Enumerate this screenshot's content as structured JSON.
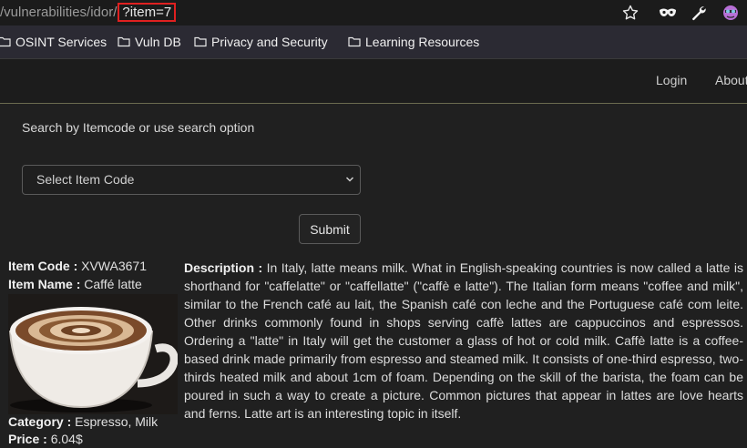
{
  "browser": {
    "url_path": "/vulnerabilities/idor/",
    "url_query": "?item=7"
  },
  "bookmarks": [
    {
      "label": "OSINT Services"
    },
    {
      "label": "Vuln DB"
    },
    {
      "label": "Privacy and Security"
    },
    {
      "label": "Learning Resources"
    }
  ],
  "nav": {
    "login": "Login",
    "about": "About"
  },
  "search": {
    "label": "Search by Itemcode or use search option",
    "select_value": "Select Item Code",
    "submit": "Submit"
  },
  "item": {
    "code_label": "Item Code :",
    "code": " XVWA3671",
    "name_label": "Item Name :",
    "name": " Caffé latte",
    "category_label": "Category :",
    "category": " Espresso, Milk",
    "price_label": "Price :",
    "price": " 6.04$",
    "description_label": "Description :",
    "description": " In Italy, latte means milk. What in English-speaking countries is now called a latte is shorthand for \"caffelatte\" or \"caffellatte\" (\"caffè e latte\"). The Italian form means \"coffee and milk\", similar to the French café au lait, the Spanish café con leche and the Portuguese café com leite. Other drinks commonly found in shops serving caffè lattes are cappuccinos and espressos. Ordering a \"latte\" in Italy will get the customer a glass of hot or cold milk. Caffè latte is a coffee-based drink made primarily from espresso and steamed milk. It consists of one-third espresso, two-thirds heated milk and about 1cm of foam. Depending on the skill of the barista, the foam can be poured in such a way to create a picture. Common pictures that appear in lattes are love hearts and ferns. Latte art is an interesting topic in itself."
  }
}
